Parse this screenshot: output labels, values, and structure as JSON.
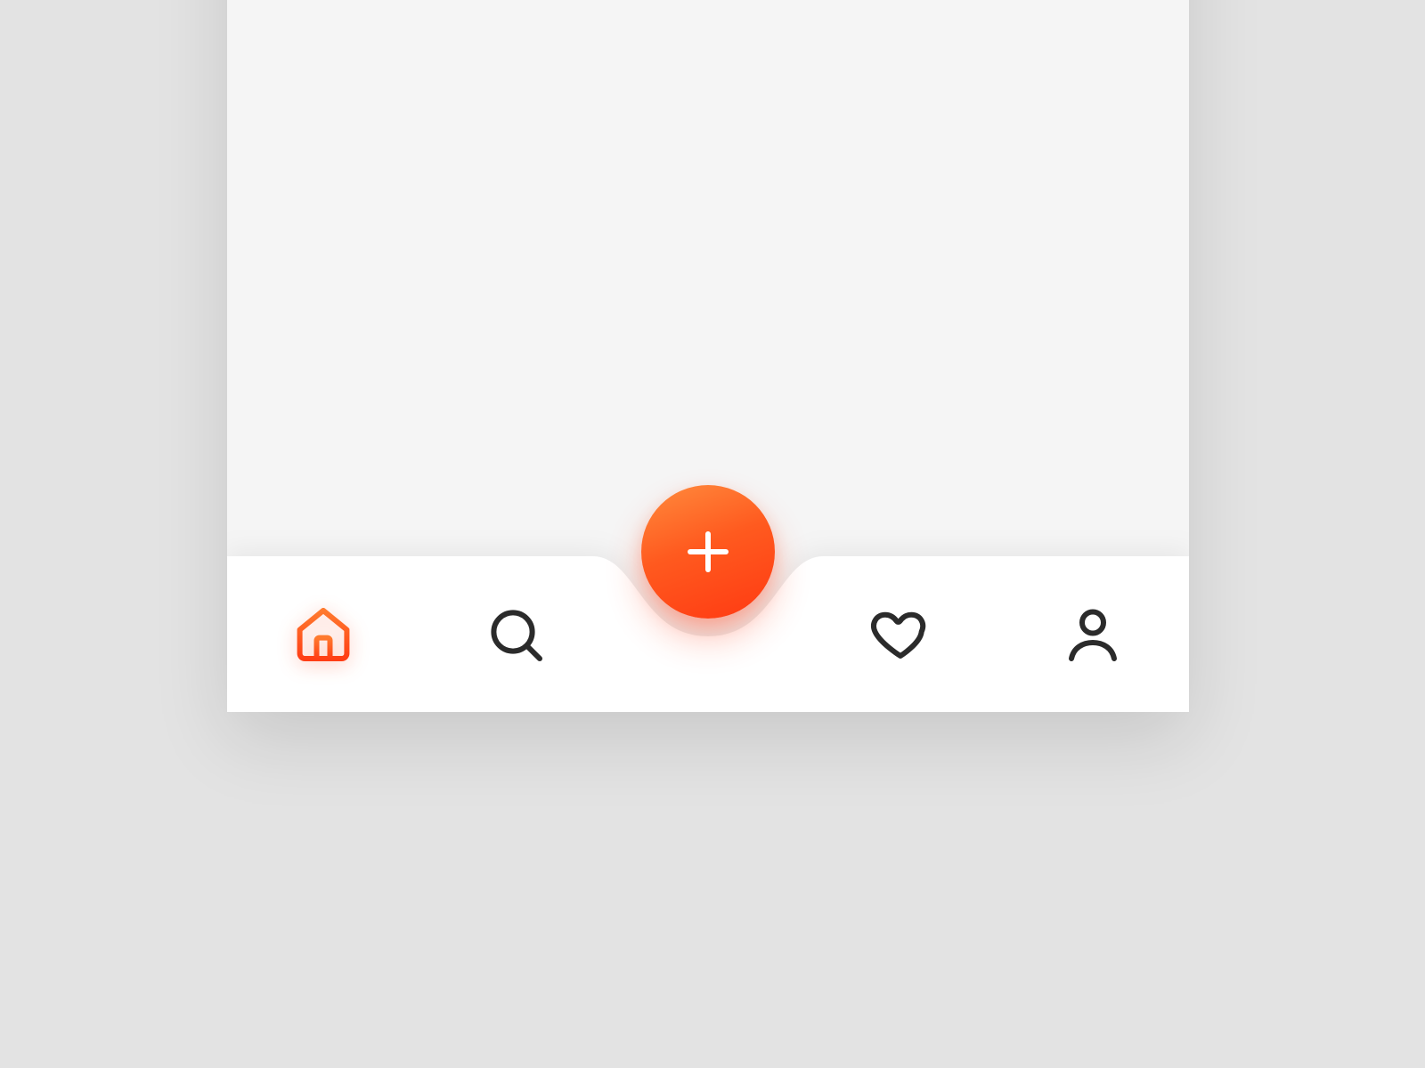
{
  "nav": {
    "items": [
      {
        "id": "home",
        "icon": "home-icon",
        "label": "Home",
        "active": true
      },
      {
        "id": "search",
        "icon": "search-icon",
        "label": "Search",
        "active": false
      },
      {
        "id": "favorites",
        "icon": "heart-icon",
        "label": "Favorites",
        "active": false
      },
      {
        "id": "profile",
        "icon": "user-icon",
        "label": "Profile",
        "active": false
      }
    ],
    "fab": {
      "icon": "plus-icon",
      "label": "Add"
    }
  },
  "colors": {
    "accent_gradient_start": "#ff8b3d",
    "accent_gradient_end": "#ff3a12",
    "icon_inactive": "#2b2b2b",
    "icon_active_start": "#ff7a2e",
    "icon_active_end": "#ff3e15",
    "nav_bg": "#ffffff",
    "page_bg": "#f5f5f5",
    "outer_bg": "#e3e3e3"
  }
}
